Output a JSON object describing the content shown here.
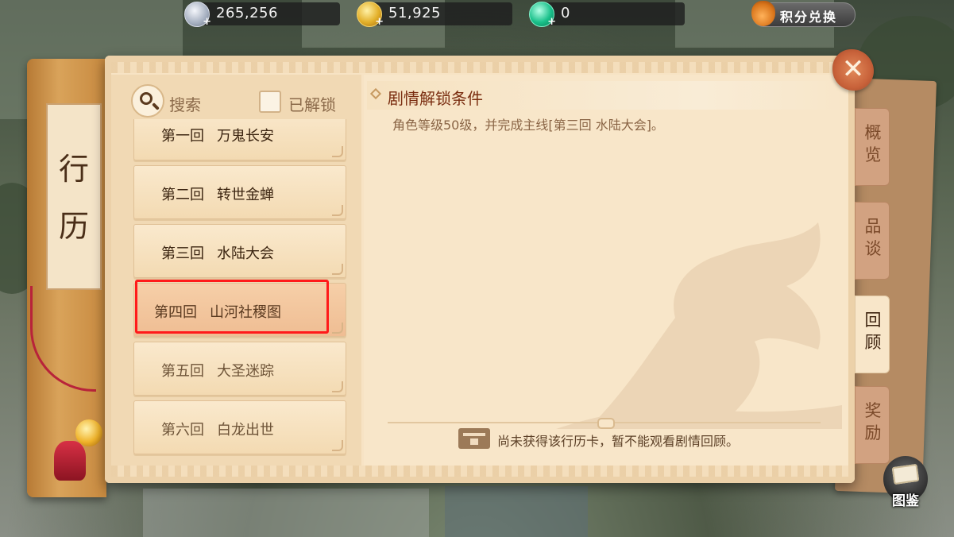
{
  "currency": {
    "silver": "265,256",
    "gold": "51,925",
    "jade": "0",
    "exchange_label": "积分兑换",
    "plus": "+"
  },
  "book": {
    "spine_title_1": "行",
    "spine_title_2": "历"
  },
  "list": {
    "search_label": "搜索",
    "unlocked_filter_label": "已解锁",
    "chapters": [
      {
        "num": "第一回",
        "title": "万鬼长安",
        "state": "unlocked"
      },
      {
        "num": "第二回",
        "title": "转世金蝉",
        "state": "unlocked"
      },
      {
        "num": "第三回",
        "title": "水陆大会",
        "state": "unlocked"
      },
      {
        "num": "第四回",
        "title": "山河社稷图",
        "state": "selected"
      },
      {
        "num": "第五回",
        "title": "大圣迷踪",
        "state": "locked"
      },
      {
        "num": "第六回",
        "title": "白龙出世",
        "state": "locked"
      }
    ]
  },
  "detail": {
    "section_title": "剧情解锁条件",
    "condition": "角色等级50级，并完成主线[第三回 水陆大会]。",
    "notice": "尚未获得该行历卡，暂不能观看剧情回顾。"
  },
  "tabs": [
    {
      "line1": "概",
      "line2": "览"
    },
    {
      "line1": "品",
      "line2": "谈"
    },
    {
      "line1": "回",
      "line2": "顾"
    },
    {
      "line1": "奖",
      "line2": "励"
    }
  ],
  "close_label": "✕",
  "atlas_label": "图鉴",
  "colors": {
    "panel": "#f7e3c4",
    "highlight": "#ff1a1a",
    "section_title": "#7a2d10"
  }
}
